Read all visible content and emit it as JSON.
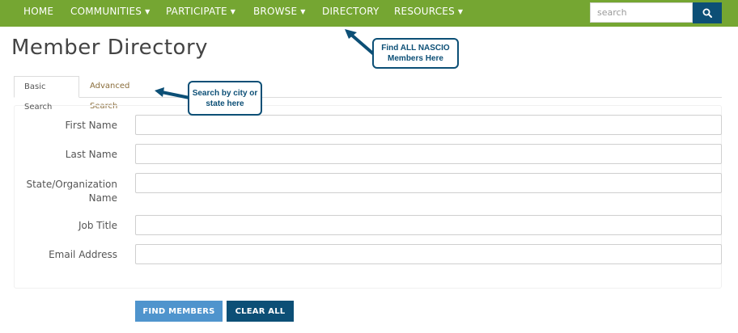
{
  "nav": {
    "items": [
      {
        "label": "HOME",
        "has_dropdown": false
      },
      {
        "label": "COMMUNITIES",
        "has_dropdown": true
      },
      {
        "label": "PARTICIPATE",
        "has_dropdown": true
      },
      {
        "label": "BROWSE",
        "has_dropdown": true
      },
      {
        "label": "DIRECTORY",
        "has_dropdown": false
      },
      {
        "label": "RESOURCES",
        "has_dropdown": true
      }
    ],
    "caret": "▼",
    "search_placeholder": "search",
    "search_icon": "search-icon"
  },
  "page": {
    "title": "Member Directory"
  },
  "tabs": {
    "basic": "Basic Search",
    "advanced": "Advanced Search"
  },
  "form": {
    "fields": [
      {
        "label": "First Name",
        "value": ""
      },
      {
        "label": "Last Name",
        "value": ""
      },
      {
        "label": "State/Organization\nName",
        "value": ""
      },
      {
        "label": "Job Title",
        "value": ""
      },
      {
        "label": "Email Address",
        "value": ""
      }
    ]
  },
  "buttons": {
    "find": "FIND MEMBERS",
    "clear": "CLEAR ALL"
  },
  "callouts": {
    "directory": "Find ALL NASCIO Members Here",
    "advanced": "Search by city or state here"
  },
  "colors": {
    "nav_bg": "#75a632",
    "accent_dark": "#0c4f76",
    "accent_light": "#4f94cd"
  }
}
